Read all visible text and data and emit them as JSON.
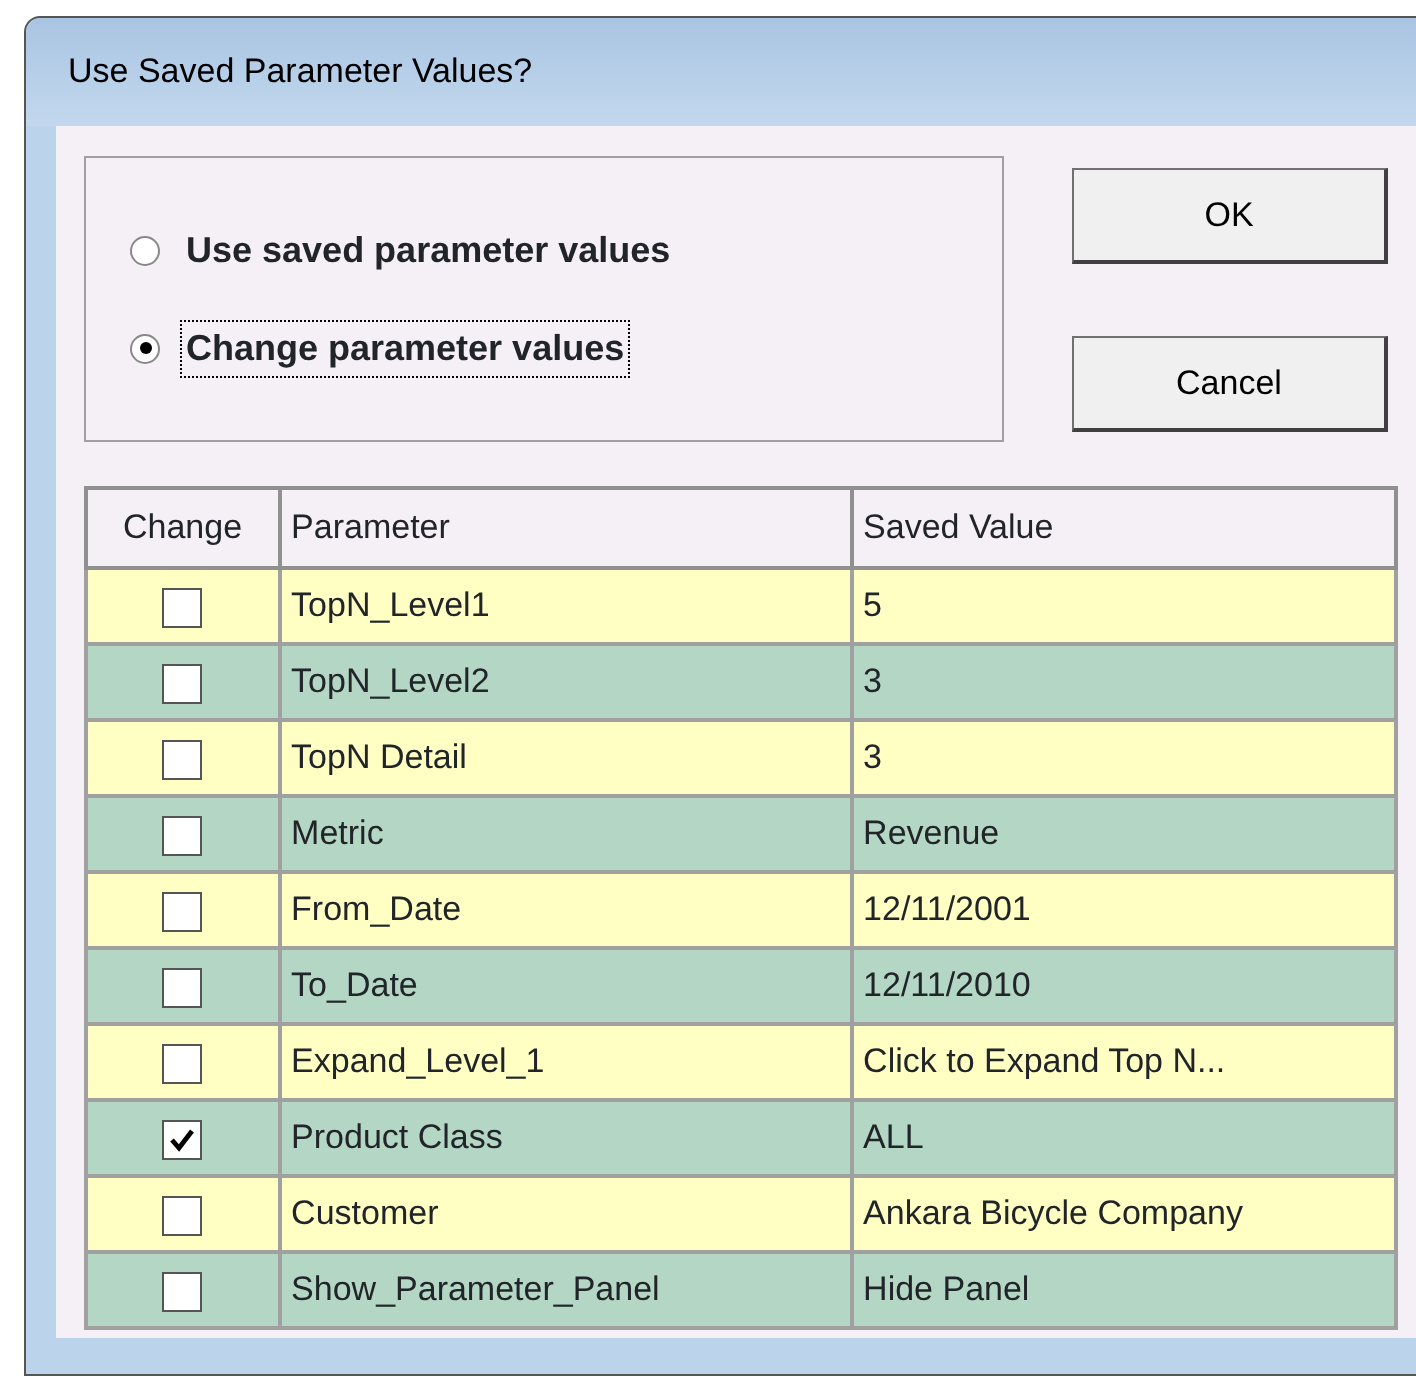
{
  "window": {
    "title": "Use Saved Parameter Values?"
  },
  "options": [
    {
      "label": "Use saved parameter values",
      "selected": false
    },
    {
      "label": "Change parameter values",
      "selected": true
    }
  ],
  "buttons": [
    "OK",
    "Cancel"
  ],
  "table": {
    "columns": [
      "Change",
      "Parameter",
      "Saved Value"
    ],
    "rows": [
      {
        "checked": false,
        "parameter": "TopN_Level1",
        "value": "5"
      },
      {
        "checked": false,
        "parameter": "TopN_Level2",
        "value": "3"
      },
      {
        "checked": false,
        "parameter": "TopN Detail",
        "value": "3"
      },
      {
        "checked": false,
        "parameter": "Metric",
        "value": "Revenue"
      },
      {
        "checked": false,
        "parameter": "From_Date",
        "value": "12/11/2001"
      },
      {
        "checked": false,
        "parameter": "To_Date",
        "value": "12/11/2010"
      },
      {
        "checked": false,
        "parameter": "Expand_Level_1",
        "value": "Click to Expand Top N..."
      },
      {
        "checked": true,
        "parameter": "Product Class",
        "value": "ALL"
      },
      {
        "checked": false,
        "parameter": "Customer",
        "value": "Ankara Bicycle Company"
      },
      {
        "checked": false,
        "parameter": "Show_Parameter_Panel",
        "value": "Hide Panel"
      }
    ]
  }
}
